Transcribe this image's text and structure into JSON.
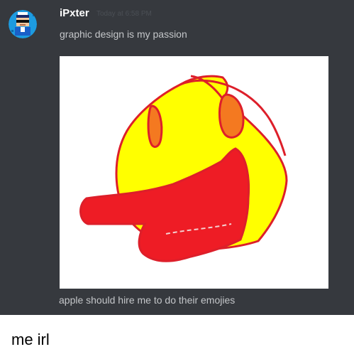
{
  "message": {
    "username": "iPxter",
    "timestamp": "Today at 6:58 PM",
    "text": "graphic design is my passion",
    "text_after_image": "apple should hire me to do their emojies"
  },
  "icons": {
    "avatar": "pixel-avatar-icon",
    "image": "drawn-pointing-emoji"
  },
  "colors": {
    "chat_background": "#36393e",
    "username": "#ffffff",
    "message_text": "#c4c6c9",
    "timestamp": "#4b4f55",
    "emoji_face": "#ffff00",
    "emoji_outline": "#dd1f2a",
    "emoji_eyes": "#f47920",
    "emoji_hand": "#ee1c25"
  },
  "caption": "me irl"
}
